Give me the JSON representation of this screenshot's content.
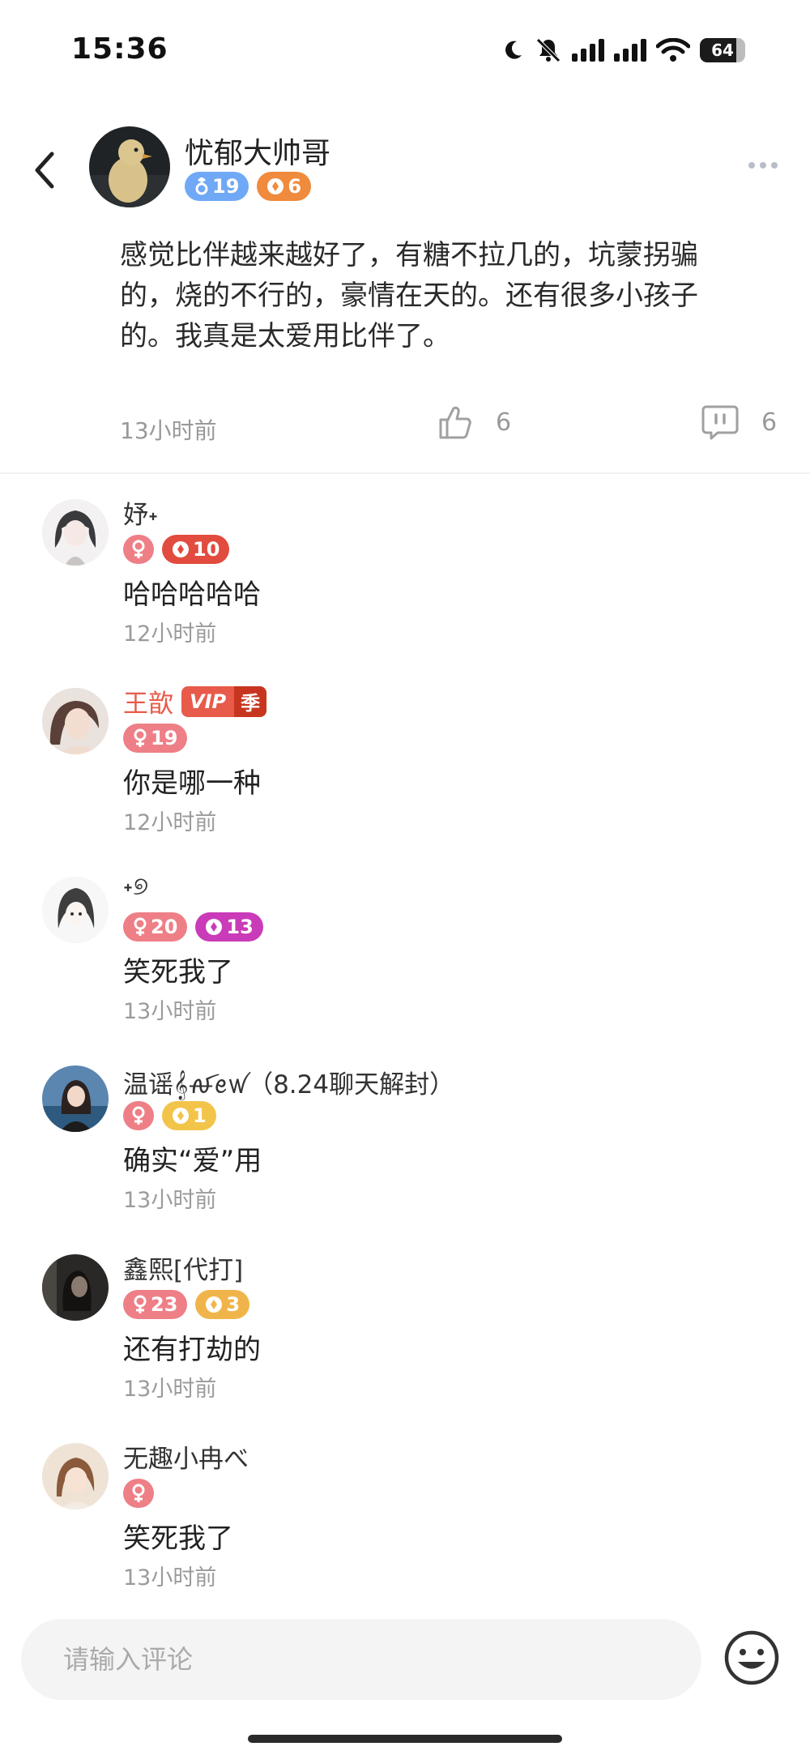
{
  "status_bar": {
    "time": "15:36",
    "battery": "64"
  },
  "post": {
    "author": "忧郁大帅哥",
    "badges": {
      "gender_level": "19",
      "level": "6"
    },
    "content": "感觉比伴越来越好了，有糖不拉几的，坑蒙拐骗的，烧的不行的，豪情在天的。还有很多小孩子的。我真是太爱用比伴了。",
    "time": "13小时前",
    "likes": "6",
    "comments": "6"
  },
  "comments": [
    {
      "name": "妤˖",
      "gender_level": "",
      "level": "10",
      "text": "哈哈哈哈哈",
      "time": "12小时前"
    },
    {
      "name": "王歆",
      "vip": "VIP",
      "vip_season": "季",
      "gender_level": "19",
      "text": "你是哪一种",
      "time": "12小时前"
    },
    {
      "name": "˖୭",
      "gender_level": "20",
      "level": "13",
      "text": "笑死我了",
      "time": "13小时前"
    },
    {
      "name": "温谣𝄞ꫛꫀꪝ（8.24聊天解封）",
      "gender_level": "",
      "level": "1",
      "text": "确实“爱”用",
      "time": "13小时前"
    },
    {
      "name": "鑫熙[代打]",
      "gender_level": "23",
      "level": "3",
      "text": "还有打劫的",
      "time": "13小时前"
    },
    {
      "name": "无趣小冉べ",
      "gender_level": "",
      "text": "笑死我了",
      "time": "13小时前"
    }
  ],
  "input": {
    "placeholder": "请输入评论"
  },
  "colors": {
    "male_badge": "#6fa8f5",
    "female_badge": "#ee7f86",
    "level_orange": "#f08a3c",
    "level_red": "#e24b3f",
    "level_purple": "#c93bb8",
    "level_yellow": "#f2c44a",
    "level_gold": "#f0b54a",
    "vip_red": "#e85a4a"
  },
  "icons": [
    "back-arrow-icon",
    "more-dots-icon",
    "thumb-up-icon",
    "comment-bubble-icon",
    "emoji-icon",
    "male-icon",
    "female-icon",
    "diamond-icon",
    "moon-icon",
    "mute-bell-icon",
    "signal-icon",
    "wifi-icon",
    "battery-icon"
  ]
}
